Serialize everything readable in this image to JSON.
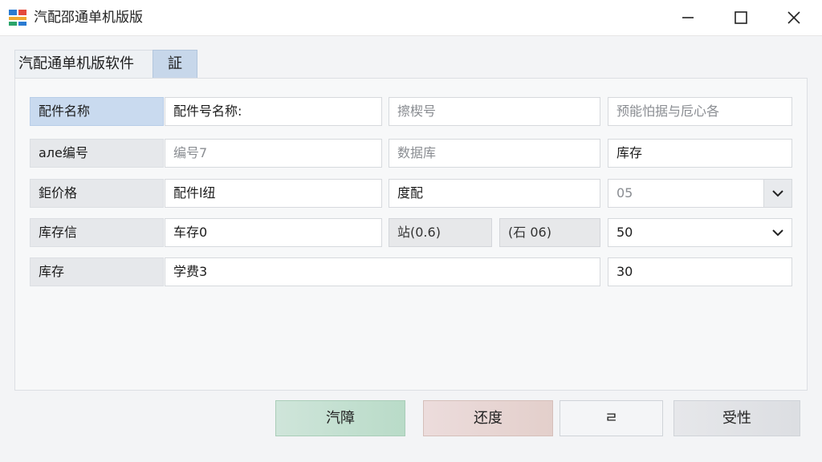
{
  "window": {
    "title": "汽配邵通单机版版",
    "controls": {
      "minimize": "minimize",
      "maximize": "maximize",
      "close": "close"
    }
  },
  "tabs": [
    {
      "label": "汽配通单机版软件",
      "active": true
    },
    {
      "label": "証",
      "active": false
    }
  ],
  "rows": [
    {
      "label": "配件名称",
      "cells": [
        {
          "value": "配件号名称:",
          "placeholder": false
        },
        {
          "value": "擦楔号",
          "placeholder": true
        },
        {
          "value": "预能怕据与卮心各",
          "placeholder": true
        }
      ]
    },
    {
      "label": "але编号",
      "cells": [
        {
          "value": "编号7",
          "placeholder": true
        },
        {
          "value": "数据库",
          "placeholder": true
        },
        {
          "value": "库存",
          "placeholder": false
        }
      ]
    },
    {
      "label": "鉅价格",
      "cells": [
        {
          "value": "配件l纽",
          "placeholder": false
        },
        {
          "value": "度配",
          "placeholder": false
        },
        {
          "value": "05",
          "placeholder": true,
          "dropdown": true
        }
      ]
    },
    {
      "label": "库存信",
      "cells": [
        {
          "value": "车存0",
          "placeholder": false
        },
        {
          "value": "站(0.6)",
          "gray": true
        },
        {
          "value": "(石 06)",
          "gray": true
        },
        {
          "value": "50",
          "placeholder": false,
          "dropdown": true
        }
      ]
    },
    {
      "label": "库存",
      "cells": [
        {
          "value": "学费3",
          "placeholder": false
        },
        {
          "value": "30",
          "placeholder": false
        }
      ]
    }
  ],
  "buttons": {
    "b1": "汽障",
    "b2": "还度",
    "b3": "ㄹ",
    "b4": "受性"
  },
  "colors": {
    "selected_label": "#c9daef",
    "btn_green": "#b9dbc8",
    "btn_red": "#e3cfcb",
    "accent_tab": "#c7d7ea"
  },
  "icons": {
    "app": "app-logo-icon",
    "dropdown": "chevron-down-icon"
  }
}
